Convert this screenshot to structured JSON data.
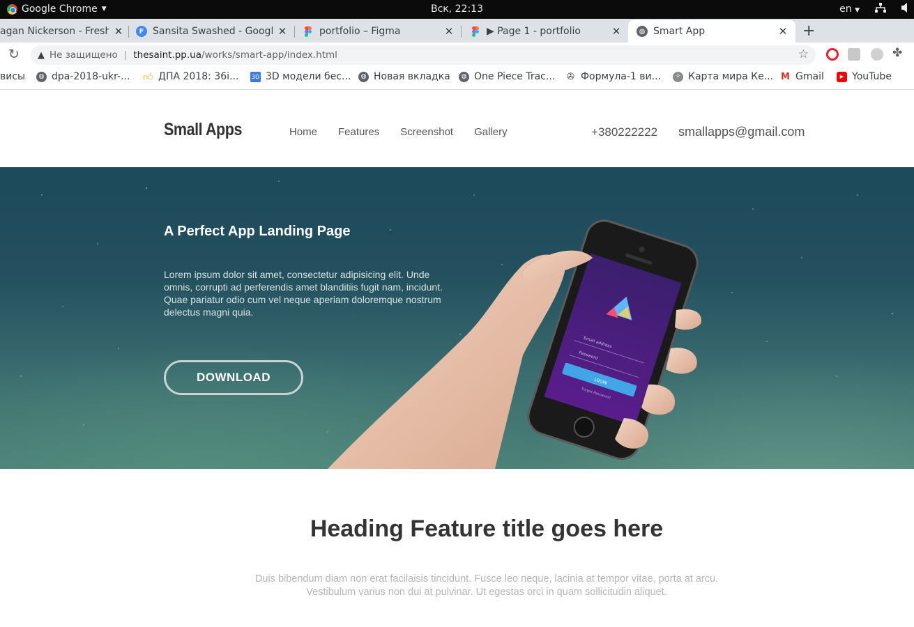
{
  "os": {
    "app_name": "Google Chrome",
    "clock": "Вск, 22:13",
    "lang": "en"
  },
  "tabs": [
    {
      "title": "agan Nickerson - Fresh",
      "icon": "web-icon"
    },
    {
      "title": "Sansita Swashed - Google",
      "icon": "google-fonts-icon"
    },
    {
      "title": "portfolio – Figma",
      "icon": "figma-icon"
    },
    {
      "title": "▶ Page 1 - portfolio",
      "icon": "figma-icon"
    },
    {
      "title": "Smart App",
      "icon": "globe-icon"
    }
  ],
  "address": {
    "security": "Не защищено",
    "host": "thesaint.pp.ua",
    "path": "/works/smart-app/index.html"
  },
  "bookmarks": [
    {
      "label": "висы"
    },
    {
      "label": "dpa-2018-ukr-..."
    },
    {
      "label": "ДПА 2018: 36і..."
    },
    {
      "label": "3D модели бес..."
    },
    {
      "label": "Новая вкладка"
    },
    {
      "label": "One Piece Trac..."
    },
    {
      "label": "Формула-1 ви..."
    },
    {
      "label": "Карта мира Ке..."
    },
    {
      "label": "Gmail"
    },
    {
      "label": "YouTube"
    }
  ],
  "site": {
    "logo": "Small Apps",
    "nav": [
      "Home",
      "Features",
      "Screenshot",
      "Gallery"
    ],
    "phone": "+380222222",
    "email": "smallapps@gmail.com"
  },
  "hero": {
    "title": "A Perfect App Landing Page",
    "text": "Lorem ipsum dolor sit amet, consectetur adipisicing elit. Unde omnis, corrupti ad perferendis amet blanditiis fugit nam, incidunt. Quae pariatur odio cum vel neque aperiam doloremque nostrum delectus magni quia.",
    "button": "DOWNLOAD",
    "phone_screen": {
      "email_placeholder": "Email address",
      "password_placeholder": "Password",
      "login": "LOGIN",
      "forgot": "Forgot Password?"
    }
  },
  "feature": {
    "title": "Heading Feature title goes here",
    "text": "Duis bibendum diam non erat facilaisis tincidunt. Fusce leo neque, lacinia at tempor vitae, porta at arcu. Vestibulum varius non dui at pulvinar. Ut egestas orci in quam sollicitudin aliquet."
  }
}
